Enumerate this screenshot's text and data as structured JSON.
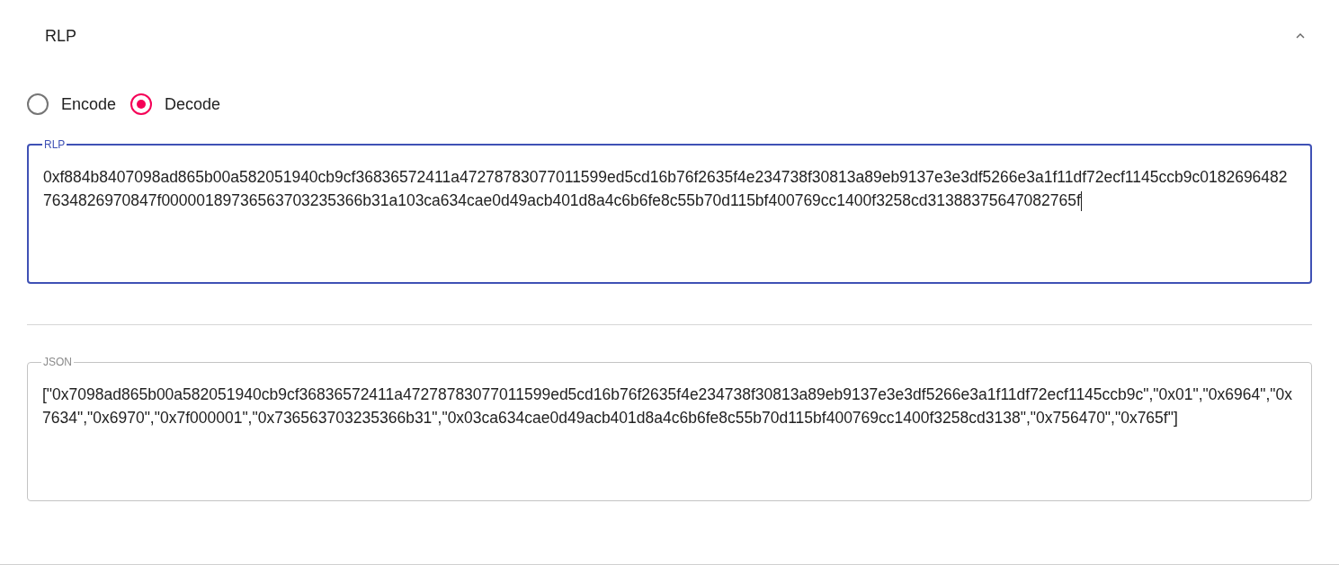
{
  "panel": {
    "title": "RLP",
    "expanded": true
  },
  "modes": [
    {
      "label": "Encode",
      "selected": false
    },
    {
      "label": "Decode",
      "selected": true
    }
  ],
  "rlp_field": {
    "label": "RLP",
    "focused": true,
    "value": "0xf884b8407098ad865b00a582051940cb9cf36836572411a47278783077011599ed5cd16b76f2635f4e234738f30813a89eb9137e3e3df5266e3a1f11df72ecf1145ccb9c01826964827634826970847f00000189736563703235366b31a103ca634cae0d49acb401d8a4c6b6fe8c55b70d115bf400769cc1400f3258cd31388375647082765f"
  },
  "json_field": {
    "label": "JSON",
    "focused": false,
    "value": "[\"0x7098ad865b00a582051940cb9cf36836572411a47278783077011599ed5cd16b76f2635f4e234738f30813a89eb9137e3e3df5266e3a1f11df72ecf1145ccb9c\",\"0x01\",\"0x6964\",\"0x7634\",\"0x6970\",\"0x7f000001\",\"0x736563703235366b31\",\"0x03ca634cae0d49acb401d8a4c6b6fe8c55b70d115bf400769cc1400f3258cd3138\",\"0x756470\",\"0x765f\"]"
  }
}
